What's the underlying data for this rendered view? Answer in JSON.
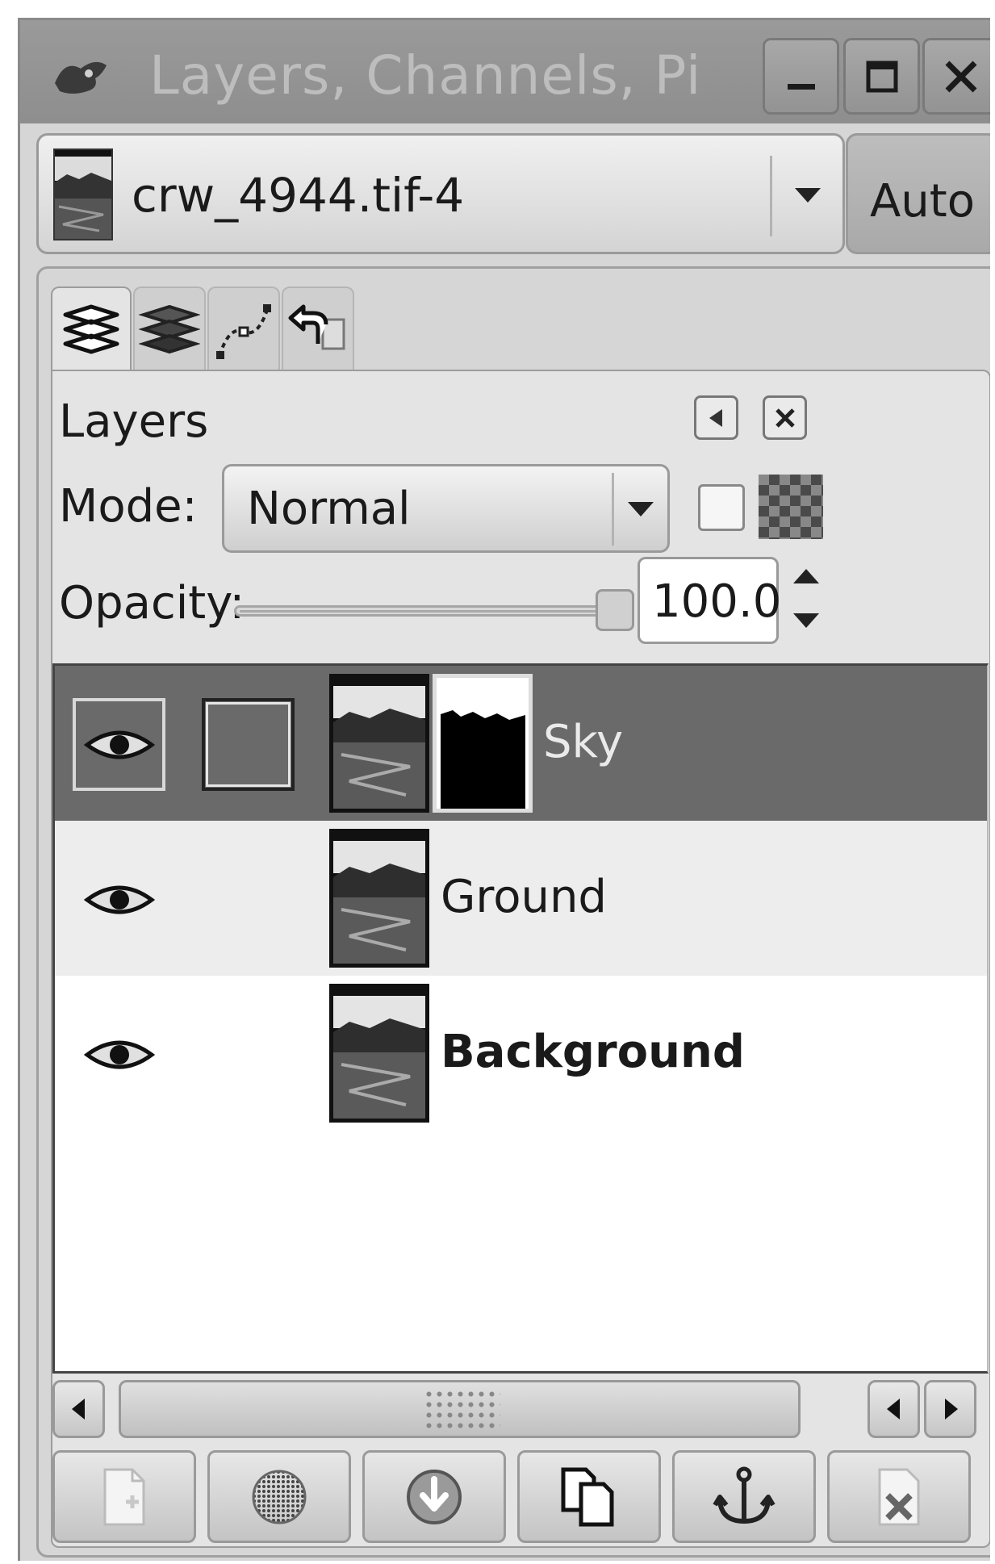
{
  "window": {
    "title": "Layers, Channels, Pi",
    "controls": [
      "minimize-icon",
      "maximize-icon",
      "close-icon"
    ]
  },
  "image_selector": {
    "value": "crw_4944.tif-4",
    "auto_label": "Auto"
  },
  "tabs": [
    {
      "icon": "layers-icon"
    },
    {
      "icon": "channels-icon"
    },
    {
      "icon": "paths-icon"
    },
    {
      "icon": "undo-history-icon"
    }
  ],
  "panel": {
    "title": "Layers",
    "mode_label": "Mode:",
    "mode_value": "Normal",
    "opacity_label": "Opacity:",
    "opacity_value": "100.0",
    "opacity_fraction": 1.0
  },
  "layers": [
    {
      "name": "Sky",
      "visible": true,
      "selected": true,
      "has_mask": true,
      "bold": false
    },
    {
      "name": "Ground",
      "visible": true,
      "selected": false,
      "has_mask": false,
      "bold": false
    },
    {
      "name": "Background",
      "visible": true,
      "selected": false,
      "has_mask": false,
      "bold": true
    }
  ],
  "footer_buttons": [
    {
      "icon": "new-layer-icon"
    },
    {
      "icon": "raise-layer-icon"
    },
    {
      "icon": "lower-layer-icon"
    },
    {
      "icon": "duplicate-layer-icon"
    },
    {
      "icon": "anchor-icon"
    },
    {
      "icon": "delete-layer-icon"
    }
  ],
  "colors": {
    "selected_row": "#6a6a6a",
    "alt_row": "#ededed",
    "titlebar": "#949494"
  }
}
